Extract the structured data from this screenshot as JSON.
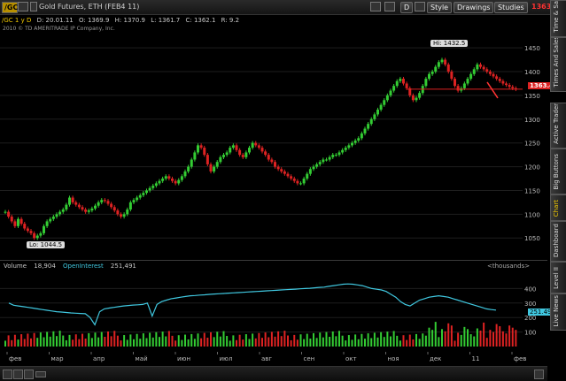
{
  "header": {
    "symbol": "/GC",
    "description": "Gold Futures, ETH (FEB4 11)",
    "zoom_label": "D",
    "style_label": "Style",
    "drawings_label": "Drawings",
    "studies_label": "Studies",
    "last_price": "1363.40"
  },
  "quote": {
    "period": "/GC 1 y D",
    "date": "D: 20.01.11",
    "open": "O: 1369.9",
    "high": "H: 1370.9",
    "low": "L: 1361.7",
    "close": "C: 1362.1",
    "range": "R: 9.2",
    "copyright": "2010 © TD AMERITRADE IP Company, Inc."
  },
  "annotations": {
    "hi_label": "Hi: 1432.5",
    "lo_label": "Lo: 1044.5",
    "price_tag": "1363.4"
  },
  "volume_header": {
    "volume_label": "Volume",
    "volume_value": "18,904",
    "oi_label": "OpenInterest",
    "oi_value": "251,491",
    "thousands": "<thousands>",
    "oi_tag": "251.49"
  },
  "side_tabs": [
    "Time & Sales",
    "Times And Sales",
    "Active Trader",
    "Big Buttons",
    "Chart",
    "Dashboard",
    "Level II",
    "Live News"
  ],
  "colors": {
    "up": "#33cc33",
    "down": "#dd2222",
    "oi": "#40c8e0",
    "priceline": "#dd2222",
    "accent": "#ff3333"
  },
  "chart_data": {
    "type": "candlestick",
    "x_tick_labels": [
      "фев",
      "мар",
      "апр",
      "май",
      "июн",
      "июл",
      "авг",
      "сен",
      "окт",
      "ноя",
      "дек",
      "11",
      "фев"
    ],
    "y_tick_labels": [
      "1450",
      "1400",
      "1350",
      "1300",
      "1250",
      "1200",
      "1150",
      "1100",
      "1050"
    ],
    "ylim": [
      1030,
      1480
    ],
    "close": [
      1105,
      1095,
      1085,
      1075,
      1090,
      1080,
      1070,
      1065,
      1060,
      1050,
      1055,
      1060,
      1075,
      1085,
      1090,
      1095,
      1100,
      1105,
      1110,
      1120,
      1135,
      1125,
      1120,
      1115,
      1110,
      1105,
      1108,
      1112,
      1118,
      1125,
      1130,
      1128,
      1122,
      1115,
      1108,
      1100,
      1095,
      1100,
      1110,
      1125,
      1130,
      1135,
      1140,
      1145,
      1150,
      1155,
      1160,
      1165,
      1170,
      1175,
      1180,
      1175,
      1170,
      1165,
      1172,
      1180,
      1190,
      1200,
      1215,
      1230,
      1245,
      1240,
      1225,
      1205,
      1190,
      1200,
      1210,
      1220,
      1225,
      1230,
      1240,
      1245,
      1235,
      1225,
      1220,
      1230,
      1240,
      1250,
      1245,
      1240,
      1232,
      1225,
      1215,
      1210,
      1200,
      1195,
      1190,
      1185,
      1180,
      1175,
      1170,
      1165,
      1165,
      1175,
      1185,
      1195,
      1200,
      1205,
      1210,
      1215,
      1215,
      1220,
      1225,
      1225,
      1230,
      1235,
      1240,
      1245,
      1250,
      1255,
      1260,
      1270,
      1280,
      1290,
      1300,
      1310,
      1320,
      1330,
      1340,
      1350,
      1360,
      1370,
      1380,
      1385,
      1375,
      1365,
      1350,
      1340,
      1345,
      1355,
      1370,
      1385,
      1395,
      1400,
      1410,
      1420,
      1425,
      1415,
      1400,
      1385,
      1370,
      1360,
      1365,
      1375,
      1385,
      1395,
      1405,
      1415,
      1410,
      1405,
      1400,
      1395,
      1390,
      1385,
      1380,
      1375,
      1372,
      1368,
      1365,
      1363
    ],
    "open_interest_k": [
      300,
      285,
      280,
      275,
      270,
      265,
      260,
      255,
      250,
      245,
      240,
      238,
      235,
      232,
      230,
      228,
      226,
      200,
      150,
      240,
      260,
      265,
      270,
      275,
      280,
      283,
      286,
      288,
      290,
      300,
      210,
      290,
      310,
      320,
      330,
      335,
      340,
      345,
      350,
      352,
      355,
      357,
      360,
      362,
      364,
      366,
      368,
      370,
      372,
      374,
      376,
      378,
      380,
      382,
      384,
      386,
      388,
      390,
      392,
      394,
      396,
      398,
      400,
      402,
      405,
      408,
      410,
      415,
      420,
      425,
      430,
      432,
      430,
      425,
      420,
      410,
      400,
      395,
      390,
      380,
      360,
      340,
      310,
      290,
      280,
      300,
      320,
      330,
      340,
      345,
      350,
      345,
      340,
      330,
      320,
      310,
      300,
      290,
      280,
      270,
      260,
      255,
      251
    ],
    "volume_ylim": [
      0,
      500
    ],
    "volume_tick_labels": [
      "400",
      "300",
      "200",
      "100"
    ]
  }
}
